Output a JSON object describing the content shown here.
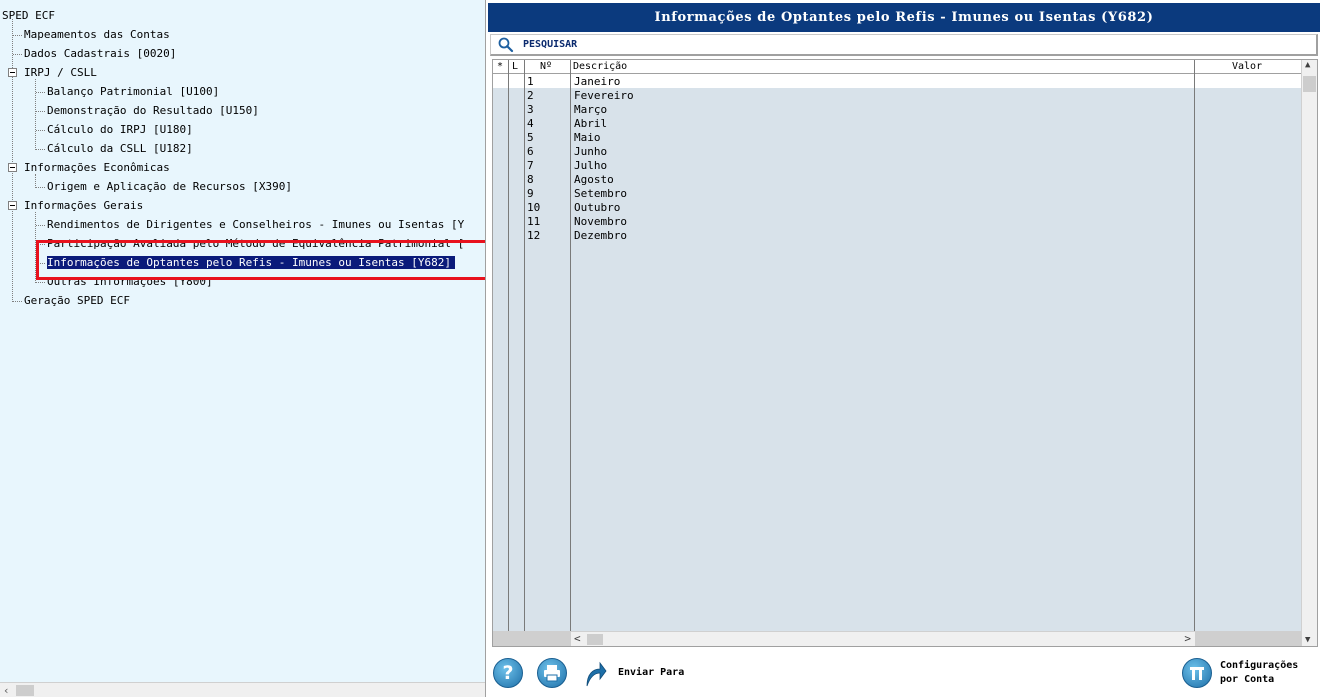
{
  "tree": {
    "root": "SPED ECF",
    "items": [
      {
        "label": "Mapeamentos das Contas"
      },
      {
        "label": "Dados Cadastrais [0020]"
      },
      {
        "label": "IRPJ / CSLL"
      },
      {
        "label": "Balanço Patrimonial [U100]"
      },
      {
        "label": "Demonstração do Resultado [U150]"
      },
      {
        "label": "Cálculo do IRPJ [U180]"
      },
      {
        "label": "Cálculo da CSLL [U182]"
      },
      {
        "label": "Informações Econômicas"
      },
      {
        "label": "Origem e Aplicação de Recursos [X390]"
      },
      {
        "label": "Informações Gerais"
      },
      {
        "label": "Rendimentos de Dirigentes e Conselheiros - Imunes ou Isentas [Y"
      },
      {
        "label": "Participação Avaliada pelo Método de Equivalência Patrimonial ["
      },
      {
        "label": "Informações de Optantes pelo Refis - Imunes ou Isentas [Y682]"
      },
      {
        "label": "Outras Informações [Y800]"
      },
      {
        "label": "Geração SPED ECF"
      }
    ]
  },
  "panel": {
    "title": "Informações de Optantes pelo Refis - Imunes ou Isentas (Y682)",
    "search_label": "PESQUISAR"
  },
  "grid": {
    "headers": {
      "star": "*",
      "l": "L",
      "num": "Nº",
      "desc": "Descrição",
      "valor": "Valor"
    },
    "rows": [
      {
        "num": "1",
        "desc": "Janeiro"
      },
      {
        "num": "2",
        "desc": "Fevereiro"
      },
      {
        "num": "3",
        "desc": "Março"
      },
      {
        "num": "4",
        "desc": "Abril"
      },
      {
        "num": "5",
        "desc": "Maio"
      },
      {
        "num": "6",
        "desc": "Junho"
      },
      {
        "num": "7",
        "desc": "Julho"
      },
      {
        "num": "8",
        "desc": "Agosto"
      },
      {
        "num": "9",
        "desc": "Setembro"
      },
      {
        "num": "10",
        "desc": "Outubro"
      },
      {
        "num": "11",
        "desc": "Novembro"
      },
      {
        "num": "12",
        "desc": "Dezembro"
      }
    ]
  },
  "bottom": {
    "help_icon": "question-mark-icon",
    "print_icon": "printer-icon",
    "send_icon": "share-arrow-icon",
    "send_label": "Enviar Para",
    "config_icon": "settings-icon",
    "config_label_1": "Configurações",
    "config_label_2": "por Conta"
  }
}
